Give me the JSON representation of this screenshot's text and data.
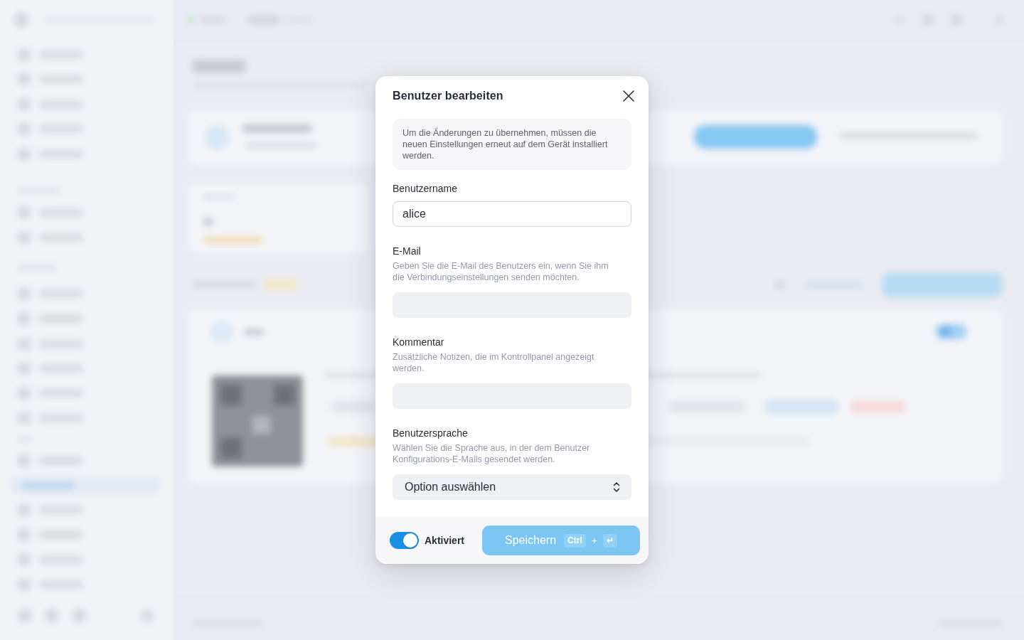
{
  "dialog": {
    "title": "Benutzer bearbeiten",
    "notice": "Um die Änderungen zu übernehmen, müssen die neuen Einstellungen erneut auf dem Gerät installiert werden.",
    "fields": [
      {
        "kind": "text",
        "label": "Benutzername",
        "value": "alice"
      },
      {
        "kind": "text",
        "label": "E-Mail",
        "description": "Geben Sie die E-Mail des Benutzers ein, wenn Sie ihm die Verbindungseinstellungen senden möchten."
      },
      {
        "kind": "text",
        "label": "Kommentar",
        "description": "Zusätzliche Notizen, die im Kontrollpanel angezeigt werden."
      },
      {
        "kind": "select",
        "label": "Benutzersprache",
        "description": "Wählen Sie die Sprache aus, in der dem Benutzer Konfigurations-E-Mails gesendet werden.",
        "placeholder": "Option auswählen"
      }
    ],
    "footer": {
      "toggle": {
        "label": "Aktiviert",
        "on": true
      },
      "save_button": {
        "label": "Speichern",
        "disabled": true,
        "shortcut": [
          {
            "kind": "key",
            "text": "Ctrl"
          },
          {
            "kind": "joiner",
            "text": "+"
          },
          {
            "kind": "key",
            "text": "↵"
          }
        ]
      }
    }
  }
}
